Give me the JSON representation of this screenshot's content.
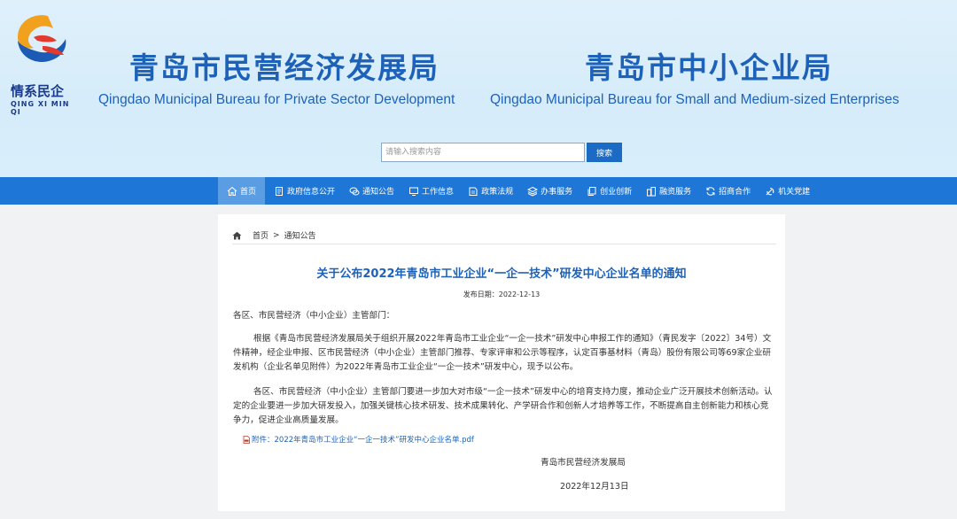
{
  "header": {
    "logo": {
      "cn": "情系民企",
      "en": "QING XI MIN QI"
    },
    "left": {
      "cn": "青岛市民营经济发展局",
      "en": "Qingdao Municipal Bureau for Private Sector Development"
    },
    "right": {
      "cn": "青岛市中小企业局",
      "en": "Qingdao Municipal Bureau for Small and Medium-sized Enterprises"
    }
  },
  "search": {
    "placeholder": "请输入搜索内容",
    "button": "搜索"
  },
  "nav": {
    "items": [
      {
        "label": "首页",
        "icon": "home-icon"
      },
      {
        "label": "政府信息公开",
        "icon": "document-icon"
      },
      {
        "label": "通知公告",
        "icon": "chat-icon"
      },
      {
        "label": "工作信息",
        "icon": "monitor-icon"
      },
      {
        "label": "政策法规",
        "icon": "book-icon"
      },
      {
        "label": "办事服务",
        "icon": "layers-icon"
      },
      {
        "label": "创业创新",
        "icon": "copy-icon"
      },
      {
        "label": "融资服务",
        "icon": "buildings-icon"
      },
      {
        "label": "招商合作",
        "icon": "refresh-icon"
      },
      {
        "label": "机关党建",
        "icon": "party-icon"
      }
    ],
    "active_index": 0
  },
  "breadcrumb": {
    "home": "首页",
    "separator": ">",
    "current": "通知公告"
  },
  "article": {
    "title": "关于公布2022年青岛市工业企业“一企一技术”研发中心企业名单的通知",
    "date_label": "发布日期：",
    "date": "2022-12-13",
    "salutation": "各区、市民营经济（中小企业）主管部门：",
    "paragraphs": [
      "根据《青岛市民营经济发展局关于组织开展2022年青岛市工业企业“一企一技术”研发中心申报工作的通知》（青民发字〔2022〕34号）文件精神，经企业申报、区市民营经济（中小企业）主管部门推荐、专家评审和公示等程序，认定百事基材料（青岛）股份有限公司等69家企业研发机构（企业名单见附件）为2022年青岛市工业企业“一企一技术”研发中心，现予以公布。",
      "各区、市民营经济（中小企业）主管部门要进一步加大对市级“一企一技术”研发中心的培育支持力度，推动企业广泛开展技术创新活动。认定的企业要进一步加大研发投入，加强关键核心技术研发、技术成果转化、产学研合作和创新人才培养等工作，不断提高自主创新能力和核心竞争力，促进企业高质量发展。"
    ],
    "attachment": "附件：2022年青岛市工业企业“一企一技术”研发中心企业名单.pdf",
    "signature_org": "青岛市民营经济发展局",
    "signature_date": "2022年12月13日"
  }
}
